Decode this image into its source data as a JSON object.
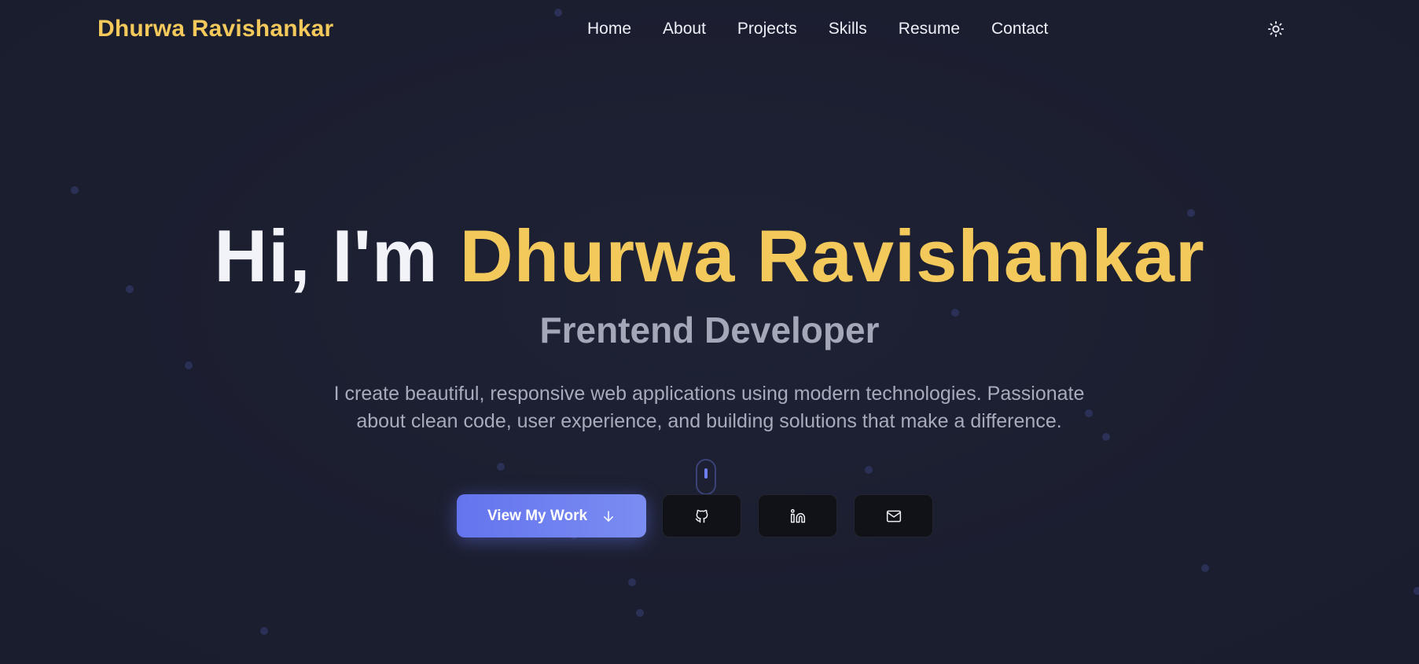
{
  "brand": "Dhurwa Ravishankar",
  "nav": {
    "items": [
      {
        "label": "Home"
      },
      {
        "label": "About"
      },
      {
        "label": "Projects"
      },
      {
        "label": "Skills"
      },
      {
        "label": "Resume"
      },
      {
        "label": "Contact"
      }
    ],
    "theme_toggle_icon": "sun-icon"
  },
  "hero": {
    "greeting": "Hi, I'm",
    "name": "Dhurwa Ravishankar",
    "role": "Frentend Developer",
    "description": "I create beautiful, responsive web applications using modern technologies. Passionate about clean code, user experience, and building solutions that make a difference.",
    "cta_label": "View My Work",
    "cta_icon": "arrow-down-icon",
    "social_icons": [
      "github-icon",
      "linkedin-icon",
      "mail-icon"
    ]
  },
  "colors": {
    "background": "#1c1f30",
    "accent_yellow": "#f3c95c",
    "accent_blue": "#6b7cf0",
    "text_light": "#eef0f7",
    "text_muted": "#a4a7b8"
  }
}
